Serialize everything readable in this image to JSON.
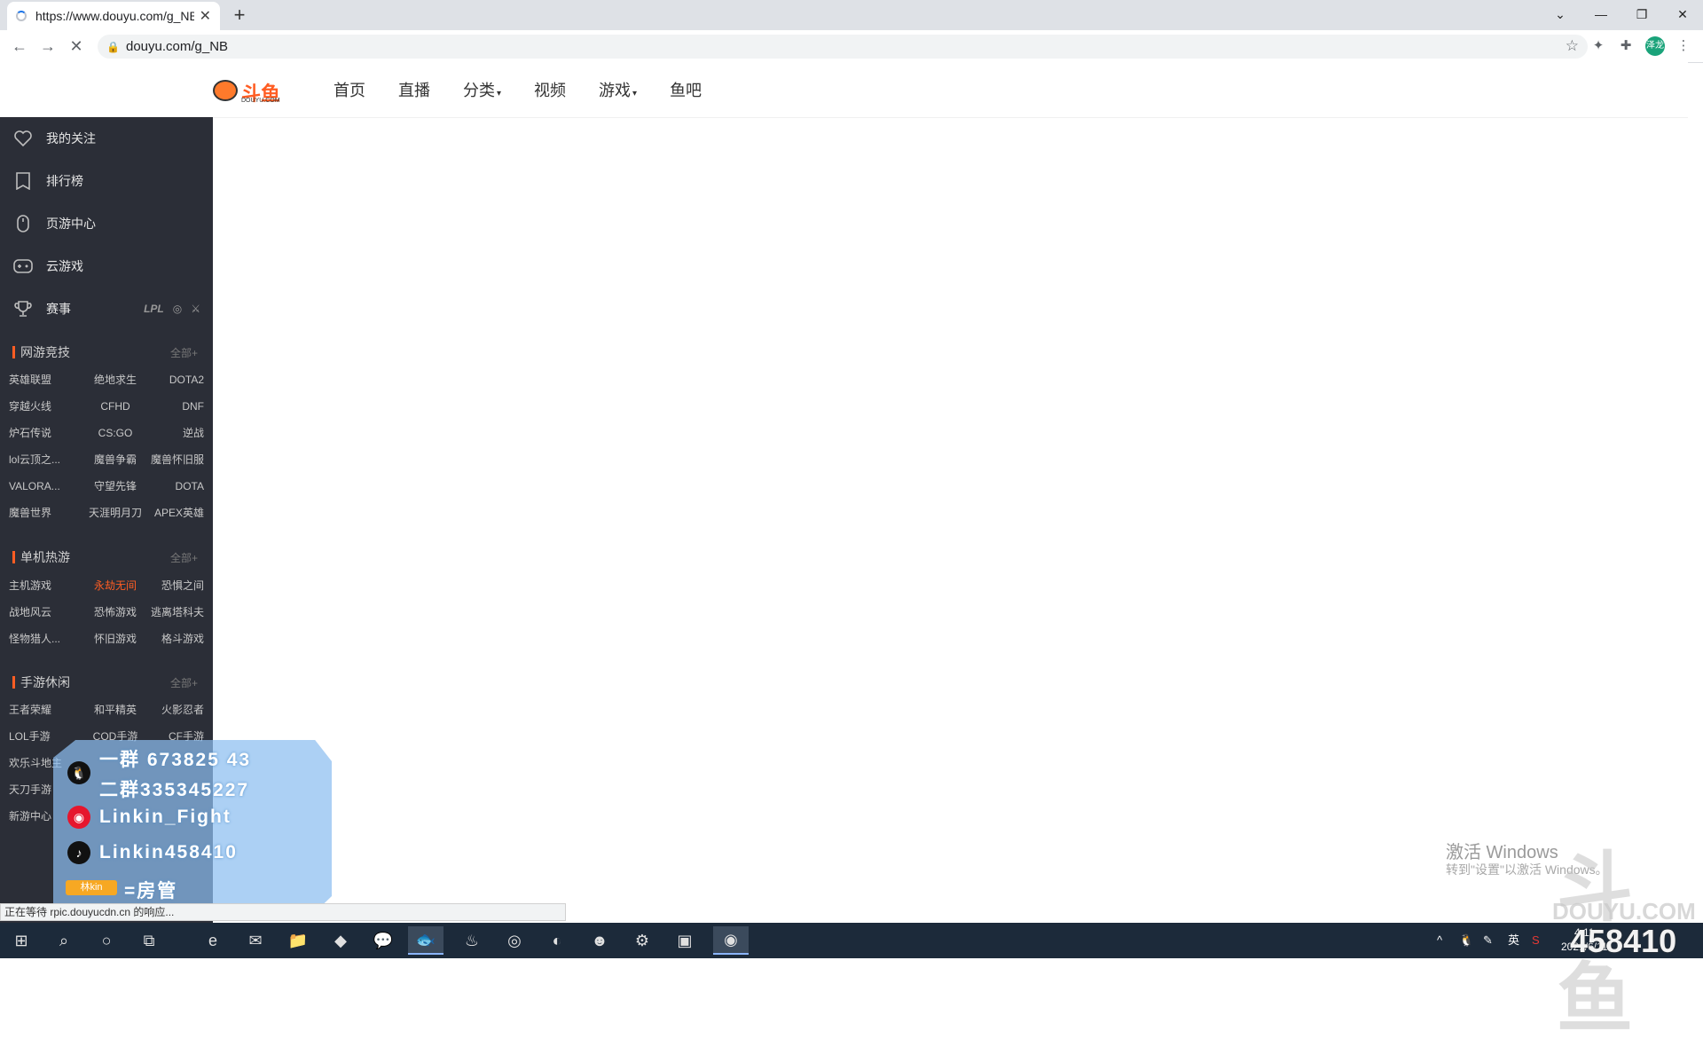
{
  "browser": {
    "tab_title": "https://www.douyu.com/g_NB",
    "tab_close": "✕",
    "new_tab": "+",
    "url": "douyu.com/g_NB",
    "win_controls": {
      "minimize": "—",
      "restore": "❐",
      "close": "✕"
    },
    "profile_label": "泽龙",
    "status_text": "正在等待 rpic.douyucdn.cn 的响应..."
  },
  "site": {
    "logo_text": "斗鱼",
    "logo_sub": "DOUYU.COM",
    "nav": [
      {
        "label": "首页"
      },
      {
        "label": "直播"
      },
      {
        "label": "分类",
        "caret": "▾"
      },
      {
        "label": "视频"
      },
      {
        "label": "游戏",
        "caret": "▾"
      },
      {
        "label": "鱼吧"
      }
    ]
  },
  "sidebar": {
    "links": [
      {
        "label": "我的关注",
        "icon": "heart-icon"
      },
      {
        "label": "排行榜",
        "icon": "ranking-icon"
      },
      {
        "label": "页游中心",
        "icon": "mouse-icon"
      },
      {
        "label": "云游戏",
        "icon": "gamepad-icon"
      },
      {
        "label": "赛事",
        "icon": "trophy-icon"
      }
    ],
    "race_logos": [
      "LPL",
      "◎",
      "⚔"
    ],
    "sections": [
      {
        "title": "网游竞技",
        "all": "全部+",
        "items": [
          "英雄联盟",
          "绝地求生",
          "DOTA2",
          "穿越火线",
          "CFHD",
          "DNF",
          "炉石传说",
          "CS:GO",
          "逆战",
          "lol云顶之...",
          "魔兽争霸",
          "魔兽怀旧服",
          "VALORA...",
          "守望先锋",
          "DOTA",
          "魔兽世界",
          "天涯明月刀",
          "APEX英雄"
        ]
      },
      {
        "title": "单机热游",
        "all": "全部+",
        "items": [
          "主机游戏",
          "永劫无间",
          "恐惧之间",
          "战地风云",
          "恐怖游戏",
          "逃离塔科夫",
          "怪物猎人...",
          "怀旧游戏",
          "格斗游戏"
        ]
      },
      {
        "title": "手游休闲",
        "all": "全部+",
        "items": [
          "王者荣耀",
          "和平精英",
          "火影忍者",
          "LOL手游",
          "COD手游",
          "CF手游",
          "欢乐斗地主",
          "",
          "",
          "天刀手游",
          "",
          "",
          "新游中心",
          "",
          ""
        ]
      }
    ]
  },
  "overlay": {
    "lines": [
      "一群 673825 43",
      "二群335345227",
      "Linkin_Fight",
      "Linkin458410",
      "=房管"
    ],
    "badge": "林kin"
  },
  "watermark": {
    "activate_title": "激活 Windows",
    "activate_sub": "转到\"设置\"以激活 Windows。",
    "logo": "斗鱼",
    "sub": "DOUYU.COM",
    "room": "458410"
  },
  "taskbar": {
    "tray_lang": "英",
    "time": "4:11",
    "date": "2021/6/11"
  },
  "colors": {
    "accent": "#ff5d23",
    "sidebar_bg": "#2b2e37"
  }
}
